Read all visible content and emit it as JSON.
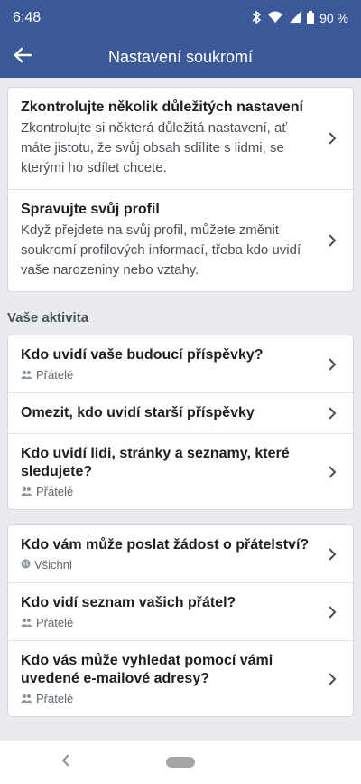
{
  "status": {
    "time": "6:48",
    "battery": "90 %"
  },
  "appbar": {
    "title": "Nastavení soukromí"
  },
  "card1": {
    "items": [
      {
        "title": "Zkontrolujte několik důležitých nastavení",
        "desc": "Zkontrolujte si některá důležitá nastavení, ať máte jistotu, že svůj obsah sdílíte s lidmi, se kterými ho sdílet chcete."
      },
      {
        "title": "Spravujte svůj profil",
        "desc": "Když přejdete na svůj profil, můžete změnit soukromí profilových informací, třeba kdo uvidí vaše narozeniny nebo vztahy."
      }
    ]
  },
  "section": {
    "activity_label": "Vaše aktivita"
  },
  "activity": {
    "items": [
      {
        "title": "Kdo uvidí vaše budoucí příspěvky?",
        "sub": "Přátelé",
        "icon": "friends-icon"
      },
      {
        "title": "Omezit, kdo uvidí starší příspěvky"
      },
      {
        "title": "Kdo uvidí lidi, stránky a seznamy, které sledujete?",
        "sub": "Přátelé",
        "icon": "friends-icon"
      }
    ]
  },
  "friends": {
    "items": [
      {
        "title": "Kdo vám může poslat žádost o přátelství?",
        "sub": "Všichni",
        "icon": "globe-icon"
      },
      {
        "title": "Kdo vidí seznam vašich přátel?",
        "sub": "Přátelé",
        "icon": "friends-icon"
      },
      {
        "title": "Kdo vás může vyhledat pomocí vámi uvedené e-mailové adresy?",
        "sub": "Přátelé",
        "icon": "friends-icon"
      }
    ]
  },
  "colors": {
    "header": "#3b5998",
    "background": "#e9ebee"
  }
}
